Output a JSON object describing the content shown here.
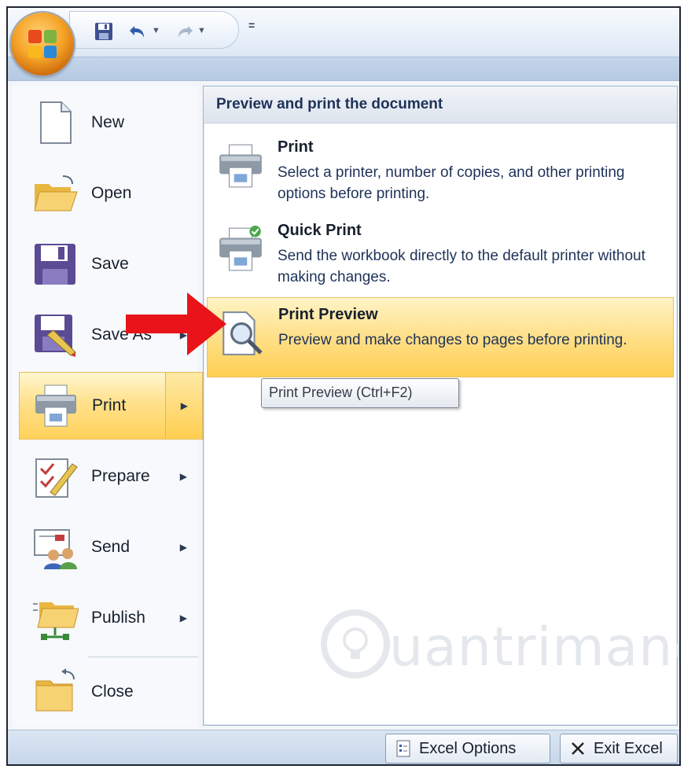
{
  "qat": {
    "buttons": [
      {
        "name": "save-icon",
        "label": "Save"
      },
      {
        "name": "undo-icon",
        "label": "Undo"
      },
      {
        "name": "redo-icon",
        "label": "Redo"
      }
    ],
    "customize_glyph": "="
  },
  "office_button": {
    "icon": "office-logo-icon"
  },
  "left_menu": {
    "items": [
      {
        "label": "New",
        "icon": "new-document-icon",
        "has_submenu": false
      },
      {
        "label": "Open",
        "icon": "open-folder-icon",
        "has_submenu": false
      },
      {
        "label": "Save",
        "icon": "floppy-disk-icon",
        "has_submenu": false
      },
      {
        "label": "Save As",
        "icon": "save-as-icon",
        "has_submenu": true
      },
      {
        "label": "Print",
        "icon": "printer-icon",
        "has_submenu": true,
        "active": true
      },
      {
        "label": "Prepare",
        "icon": "prepare-pencil-icon",
        "has_submenu": true
      },
      {
        "label": "Send",
        "icon": "send-people-icon",
        "has_submenu": true
      },
      {
        "label": "Publish",
        "icon": "publish-folder-icon",
        "has_submenu": true
      },
      {
        "label": "Close",
        "icon": "close-folder-icon",
        "has_submenu": false
      }
    ]
  },
  "right_panel": {
    "header": "Preview and print the document",
    "options": [
      {
        "title": "Print",
        "description": "Select a printer, number of copies, and other printing options before printing.",
        "icon": "printer-icon"
      },
      {
        "title": "Quick Print",
        "description": "Send the workbook directly to the default printer without making changes.",
        "icon": "quick-print-icon"
      },
      {
        "title": "Print Preview",
        "description": "Preview and make changes to pages before printing.",
        "icon": "print-preview-magnifier-icon",
        "highlighted": true
      }
    ],
    "tooltip": "Print Preview (Ctrl+F2)"
  },
  "watermark": {
    "text": "uantrimang"
  },
  "bottom_bar": {
    "excel_options": "Excel Options",
    "exit_excel": "Exit Excel"
  },
  "colors": {
    "highlight": "#ffd15a",
    "header_text": "#1e3258",
    "arrow": "#e8141a"
  }
}
